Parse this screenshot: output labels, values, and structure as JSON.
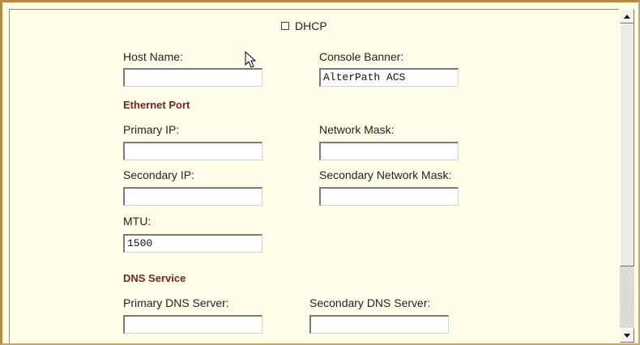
{
  "dhcp": {
    "label": "DHCP",
    "checked": false
  },
  "host_name": {
    "label": "Host Name:",
    "value": ""
  },
  "console_banner": {
    "label": "Console Banner:",
    "value": "AlterPath ACS"
  },
  "ethernet_port": {
    "heading": "Ethernet Port",
    "primary_ip": {
      "label": "Primary IP:",
      "value": ""
    },
    "network_mask": {
      "label": "Network Mask:",
      "value": ""
    },
    "secondary_ip": {
      "label": "Secondary IP:",
      "value": ""
    },
    "secondary_network_mask": {
      "label": "Secondary Network Mask:",
      "value": ""
    },
    "mtu": {
      "label": "MTU:",
      "value": "1500"
    }
  },
  "dns_service": {
    "heading": "DNS Service",
    "primary_dns": {
      "label": "Primary DNS Server:",
      "value": ""
    },
    "secondary_dns": {
      "label": "Secondary DNS Server:",
      "value": ""
    }
  },
  "colors": {
    "panel_background": "#ffffe9",
    "section_heading": "#7a1f1f",
    "frame_border": "#b98a44"
  },
  "icons": [
    "arrow-cursor-icon",
    "scroll-up-arrow-icon",
    "scroll-down-arrow-icon"
  ]
}
